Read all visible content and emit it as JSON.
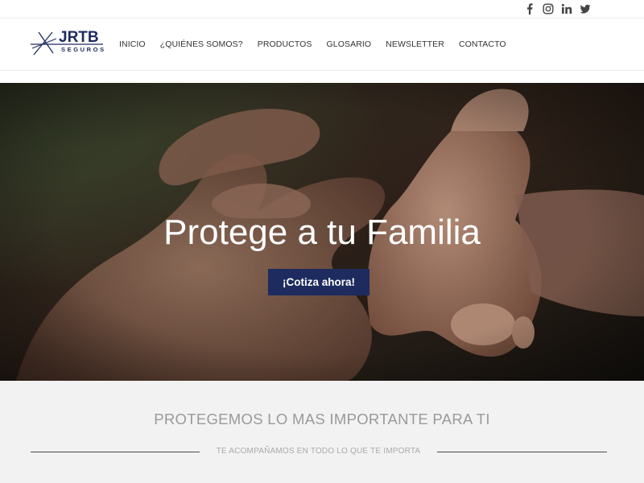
{
  "social": {
    "items": [
      {
        "icon": "facebook-icon"
      },
      {
        "icon": "instagram-icon"
      },
      {
        "icon": "linkedin-icon"
      },
      {
        "icon": "twitter-icon"
      }
    ]
  },
  "logo": {
    "brand": "JRTB",
    "sub": "SEGUROS"
  },
  "nav": {
    "items": [
      "INICIO",
      "¿QUIÉNES SOMOS?",
      "PRODUCTOS",
      "GLOSARIO",
      "NEWSLETTER",
      "CONTACTO"
    ]
  },
  "hero": {
    "title": "Protege a tu Familia",
    "cta_label": "¡Cotiza ahora!"
  },
  "section": {
    "title": "PROTEGEMOS LO MAS IMPORTANTE PARA TI",
    "subtitle": "TE ACOMPAÑAMOS EN TODO LO QUE TE IMPORTA"
  },
  "colors": {
    "brand": "#1d2b5e",
    "section_bg": "#f2f2f2"
  }
}
